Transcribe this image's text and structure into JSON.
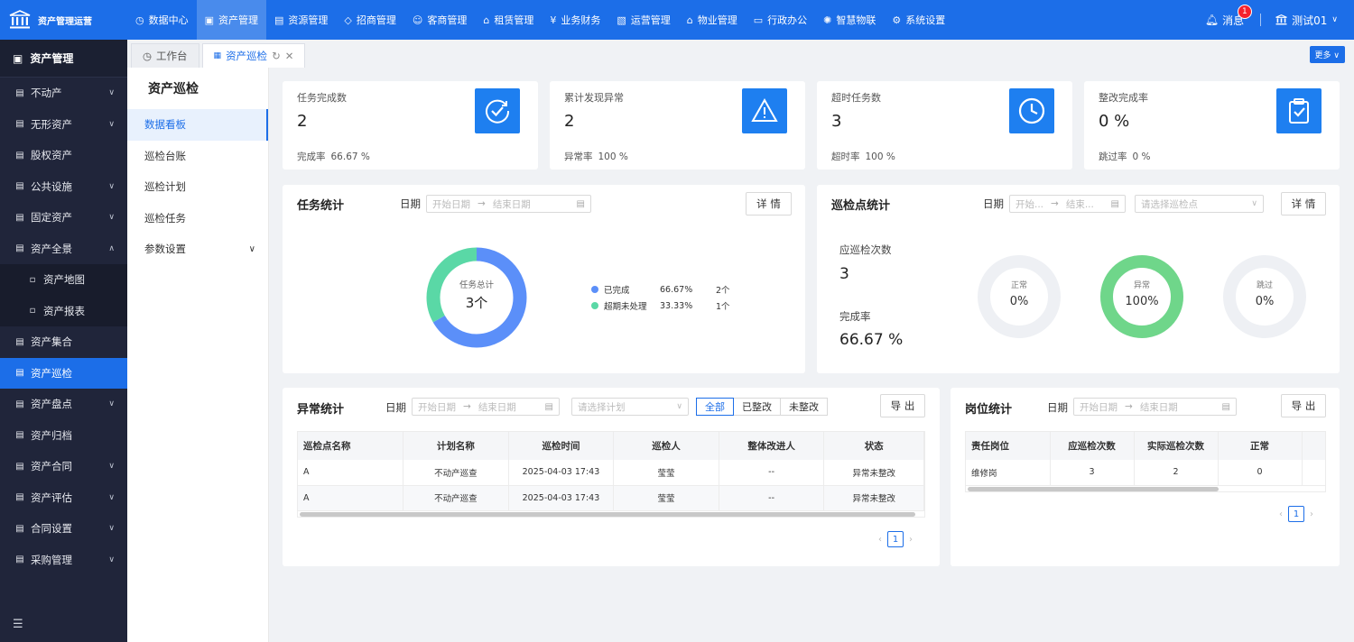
{
  "app": {
    "name": "资产管理运营"
  },
  "topnav": [
    {
      "label": "数据中心",
      "icon": "dashboard-icon"
    },
    {
      "label": "资产管理",
      "icon": "cube-icon",
      "active": true
    },
    {
      "label": "资源管理",
      "icon": "building-icon"
    },
    {
      "label": "招商管理",
      "icon": "tag-icon"
    },
    {
      "label": "客商管理",
      "icon": "users-icon"
    },
    {
      "label": "租赁管理",
      "icon": "house-icon"
    },
    {
      "label": "业务财务",
      "icon": "yen-icon"
    },
    {
      "label": "运营管理",
      "icon": "chart-icon"
    },
    {
      "label": "物业管理",
      "icon": "home-icon"
    },
    {
      "label": "行政办公",
      "icon": "monitor-icon"
    },
    {
      "label": "智慧物联",
      "icon": "iot-icon"
    },
    {
      "label": "系统设置",
      "icon": "gear-icon"
    }
  ],
  "header": {
    "messages_label": "消息",
    "messages_count": "1",
    "user": "测试01"
  },
  "sidebar": {
    "title": "资产管理",
    "items": [
      {
        "label": "不动产",
        "arrow": "down"
      },
      {
        "label": "无形资产",
        "arrow": "down"
      },
      {
        "label": "股权资产",
        "arrow": ""
      },
      {
        "label": "公共设施",
        "arrow": "down"
      },
      {
        "label": "固定资产",
        "arrow": "down"
      },
      {
        "label": "资产全景",
        "arrow": "up"
      },
      {
        "label": "资产地图",
        "arrow": "",
        "sub": true
      },
      {
        "label": "资产报表",
        "arrow": "",
        "sub": true
      },
      {
        "label": "资产集合",
        "arrow": ""
      },
      {
        "label": "资产巡检",
        "arrow": "",
        "active": true
      },
      {
        "label": "资产盘点",
        "arrow": "down"
      },
      {
        "label": "资产归档",
        "arrow": ""
      },
      {
        "label": "资产合同",
        "arrow": "down"
      },
      {
        "label": "资产评估",
        "arrow": "down"
      },
      {
        "label": "合同设置",
        "arrow": "down"
      },
      {
        "label": "采购管理",
        "arrow": "down"
      }
    ]
  },
  "tabs": [
    {
      "label": "工作台"
    },
    {
      "label": "资产巡检",
      "active": true
    }
  ],
  "more_label": "更多",
  "subnav": {
    "title": "资产巡检",
    "items": [
      {
        "label": "数据看板",
        "active": true
      },
      {
        "label": "巡检台账"
      },
      {
        "label": "巡检计划"
      },
      {
        "label": "巡检任务"
      },
      {
        "label": "参数设置",
        "arrow": true
      }
    ]
  },
  "kpis": [
    {
      "label": "任务完成数",
      "value": "2",
      "sub_label": "完成率",
      "sub_value": "66.67 %",
      "icon": "check-circle-icon"
    },
    {
      "label": "累计发现异常",
      "value": "2",
      "sub_label": "异常率",
      "sub_value": "100 %",
      "icon": "warning-icon"
    },
    {
      "label": "超时任务数",
      "value": "3",
      "sub_label": "超时率",
      "sub_value": "100 %",
      "icon": "clock-icon"
    },
    {
      "label": "整改完成率",
      "value": "0 %",
      "sub_label": "跳过率",
      "sub_value": "0 %",
      "icon": "clipboard-check-icon"
    }
  ],
  "task_stats": {
    "title": "任务统计",
    "date_label": "日期",
    "start_ph": "开始日期",
    "end_ph": "结束日期",
    "detail_btn": "详 情",
    "donut_label": "任务总计",
    "donut_value": "3个",
    "legend": [
      {
        "name": "已完成",
        "pct": "66.67%",
        "count": "2个",
        "color": "#5b8ff9"
      },
      {
        "name": "超期未处理",
        "pct": "33.33%",
        "count": "1个",
        "color": "#5ad8a6"
      }
    ]
  },
  "point_stats": {
    "title": "巡检点统计",
    "date_label": "日期",
    "start_ph": "开始...",
    "end_ph": "结束...",
    "select_ph": "请选择巡检点",
    "detail_btn": "详 情",
    "should_label": "应巡检次数",
    "should_value": "3",
    "rate_label": "完成率",
    "rate_value": "66.67 %",
    "rings": [
      {
        "name": "正常",
        "value": "0%",
        "pct": 0,
        "color": "#e8ebf0"
      },
      {
        "name": "异常",
        "value": "100%",
        "pct": 100,
        "color": "#6fd68a"
      },
      {
        "name": "跳过",
        "value": "0%",
        "pct": 0,
        "color": "#e8ebf0"
      }
    ]
  },
  "chart_data": [
    {
      "type": "pie",
      "categories": [
        "已完成",
        "超期未处理"
      ],
      "values": [
        66.67,
        33.33
      ]
    },
    {
      "type": "pie",
      "categories": [
        "正常"
      ],
      "values": [
        0
      ]
    },
    {
      "type": "pie",
      "categories": [
        "异常"
      ],
      "values": [
        100
      ]
    },
    {
      "type": "pie",
      "categories": [
        "跳过"
      ],
      "values": [
        0
      ]
    }
  ],
  "anomaly": {
    "title": "异常统计",
    "date_label": "日期",
    "start_ph": "开始日期",
    "end_ph": "结束日期",
    "plan_ph": "请选择计划",
    "filters": [
      "全部",
      "已整改",
      "未整改"
    ],
    "export_btn": "导 出",
    "columns": [
      "巡检点名称",
      "计划名称",
      "巡检时间",
      "巡检人",
      "整体改进人",
      "状态"
    ],
    "rows": [
      [
        "A",
        "不动产巡查",
        "2025-04-03 17:43",
        "莹莹",
        "--",
        "异常未整改"
      ],
      [
        "A",
        "不动产巡查",
        "2025-04-03 17:43",
        "莹莹",
        "--",
        "异常未整改"
      ]
    ],
    "page": "1"
  },
  "post": {
    "title": "岗位统计",
    "date_label": "日期",
    "start_ph": "开始日期",
    "end_ph": "结束日期",
    "export_btn": "导 出",
    "columns": [
      "责任岗位",
      "应巡检次数",
      "实际巡检次数",
      "正常"
    ],
    "rows": [
      [
        "维修岗",
        "3",
        "2",
        "0"
      ]
    ],
    "page": "1"
  }
}
